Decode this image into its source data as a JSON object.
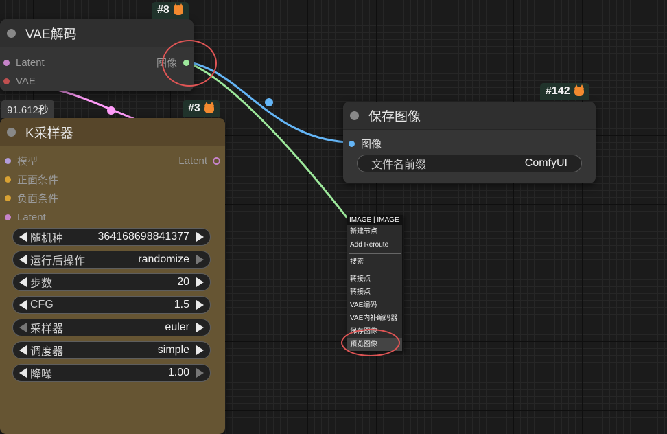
{
  "nodes": {
    "vae_decode": {
      "badge": "#8",
      "title": "VAE解码",
      "inputs": [
        "Latent",
        "VAE"
      ],
      "output": "图像"
    },
    "ksampler": {
      "badge": "#3",
      "exec_time": "91.612秒",
      "title": "K采样器",
      "inputs": [
        "模型",
        "正面条件",
        "负面条件",
        "Latent"
      ],
      "output": "Latent",
      "widgets": [
        {
          "label": "随机种",
          "value": "364168698841377"
        },
        {
          "label": "运行后操作",
          "value": "randomize"
        },
        {
          "label": "步数",
          "value": "20"
        },
        {
          "label": "CFG",
          "value": "1.5"
        },
        {
          "label": "采样器",
          "value": "euler"
        },
        {
          "label": "调度器",
          "value": "simple"
        },
        {
          "label": "降噪",
          "value": "1.00"
        }
      ]
    },
    "save_image": {
      "badge": "#142",
      "title": "保存图像",
      "input": "图像",
      "widget": {
        "label": "文件名前缀",
        "value": "ComfyUI"
      }
    }
  },
  "context_menu": {
    "title": "IMAGE | IMAGE",
    "items": [
      "新建节点",
      "Add Reroute",
      "搜索",
      "转接点",
      "转接点",
      "VAE编码",
      "VAE内补编码器",
      "保存图像",
      "预览图像"
    ],
    "highlighted": "预览图像"
  },
  "colors": {
    "node_bg": "#353535",
    "ksampler_bg": "#665533",
    "image_wire": "#64b5f6",
    "green_wire": "#9de89b",
    "latent_wire": "#ff9cf9",
    "highlight_ring": "#e05555"
  }
}
